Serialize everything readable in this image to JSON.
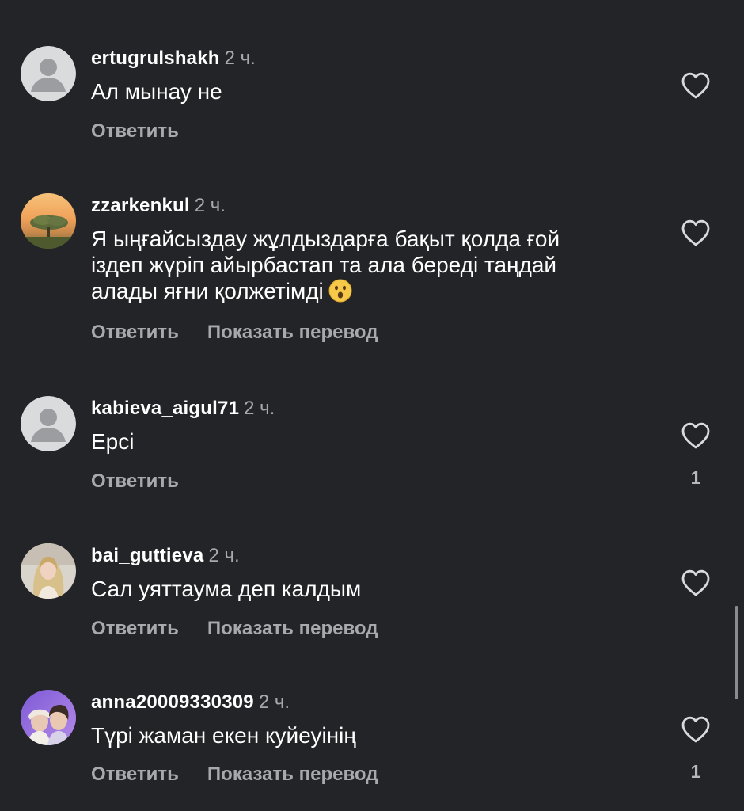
{
  "comments": [
    {
      "username": "ertugrulshakh",
      "time": "2 ч.",
      "text": "Ал мынау не",
      "reply_label": "Ответить",
      "translate_label": "",
      "likes": "",
      "avatar": "default-avatar"
    },
    {
      "username": "zzarkenkul",
      "time": "2 ч.",
      "text_lines": [
        "Я ыңғайсыздау жұлдыздарға бақыт қолда ғой",
        "іздеп жүріп айырбастап та ала береді таңдай",
        "алады яғни қолжетімді"
      ],
      "emoji": "surprised-face-emoji",
      "reply_label": "Ответить",
      "translate_label": "Показать перевод",
      "likes": "",
      "avatar": "sunset-tree-photo"
    },
    {
      "username": "kabieva_aigul71",
      "time": "2 ч.",
      "text": "Ерсі",
      "reply_label": "Ответить",
      "translate_label": "",
      "likes": "1",
      "avatar": "default-avatar"
    },
    {
      "username": "bai_guttieva",
      "time": "2 ч.",
      "text": "Сал уяттаума деп калдым",
      "reply_label": "Ответить",
      "translate_label": "Показать перевод",
      "likes": "",
      "avatar": "woman-portrait-photo"
    },
    {
      "username": "anna20009330309",
      "time": "2 ч.",
      "text": "Түрі жаман екен куйеуінің",
      "reply_label": "Ответить",
      "translate_label": "Показать перевод",
      "likes": "1",
      "avatar": "couple-selfie-photo"
    }
  ],
  "icons": {
    "like": "heart-outline-icon"
  },
  "colors": {
    "background": "#232427",
    "primary_text": "#ffffff",
    "secondary_text": "#a8a9ad",
    "icon": "#d9dadd"
  }
}
